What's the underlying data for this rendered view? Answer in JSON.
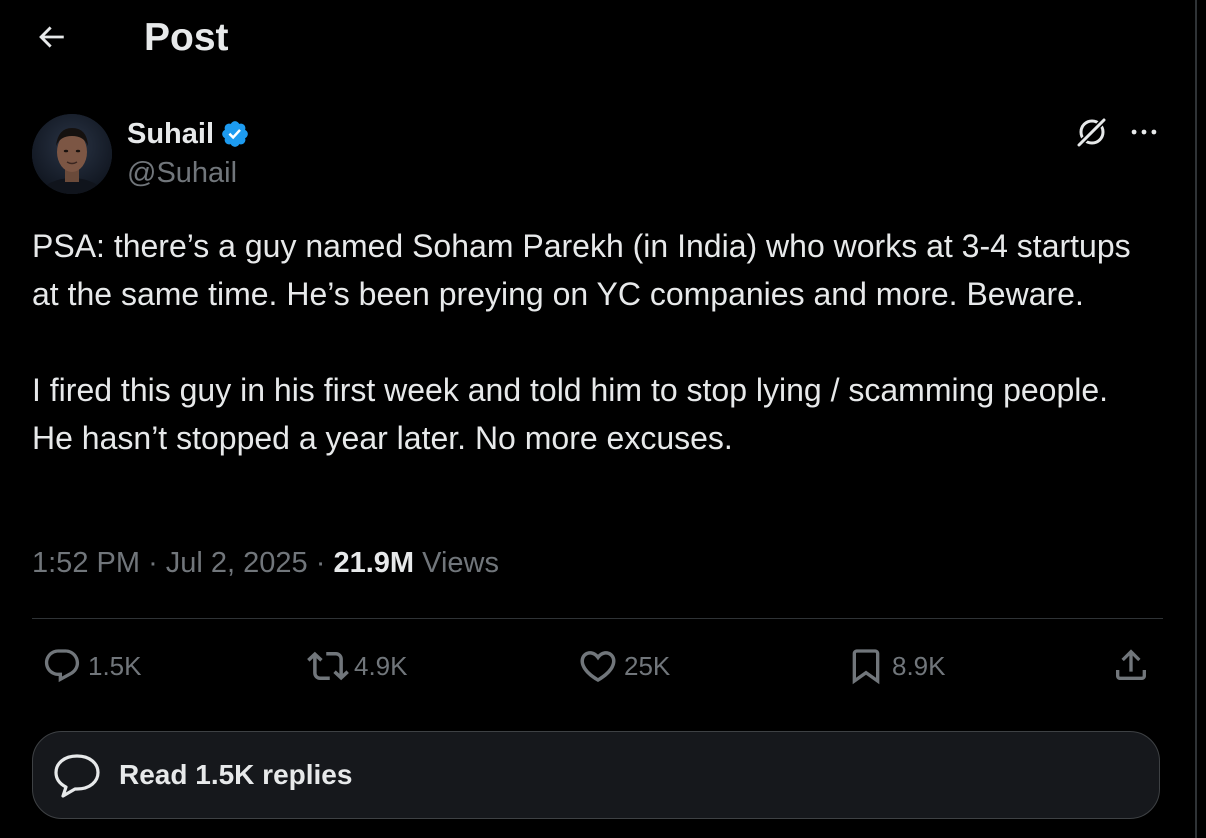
{
  "header": {
    "back_icon": "arrow-left-icon",
    "title": "Post"
  },
  "author": {
    "name": "Suhail",
    "handle": "@Suhail",
    "verified": true,
    "verified_color": "#1d9bf0"
  },
  "top_actions": {
    "grok_icon": "grok-icon",
    "more_icon": "more-horizontal-icon"
  },
  "tweet": {
    "paragraphs": [
      "PSA: there’s a guy named Soham Parekh (in India) who works at 3-4 startups at the same time. He’s been preying on YC companies and more. Beware.",
      "I fired this guy in his first week and told him to stop lying / scamming people. He hasn’t stopped a year later. No more excuses."
    ]
  },
  "meta": {
    "time": "1:52 PM",
    "separator": "·",
    "date": "Jul 2, 2025",
    "views_count": "21.9M",
    "views_label": "Views"
  },
  "actions": {
    "replies": {
      "icon": "reply-icon",
      "count": "1.5K"
    },
    "reposts": {
      "icon": "repost-icon",
      "count": "4.9K"
    },
    "likes": {
      "icon": "heart-icon",
      "count": "25K"
    },
    "bookmarks": {
      "icon": "bookmark-icon",
      "count": "8.9K"
    },
    "share": {
      "icon": "share-icon"
    }
  },
  "read_replies": {
    "icon": "speech-bubble-icon",
    "label": "Read 1.5K replies"
  },
  "colors": {
    "background": "#000000",
    "text_primary": "#e7e9ea",
    "text_secondary": "#71767b",
    "border": "#2f3336",
    "card_background": "#16181c"
  }
}
